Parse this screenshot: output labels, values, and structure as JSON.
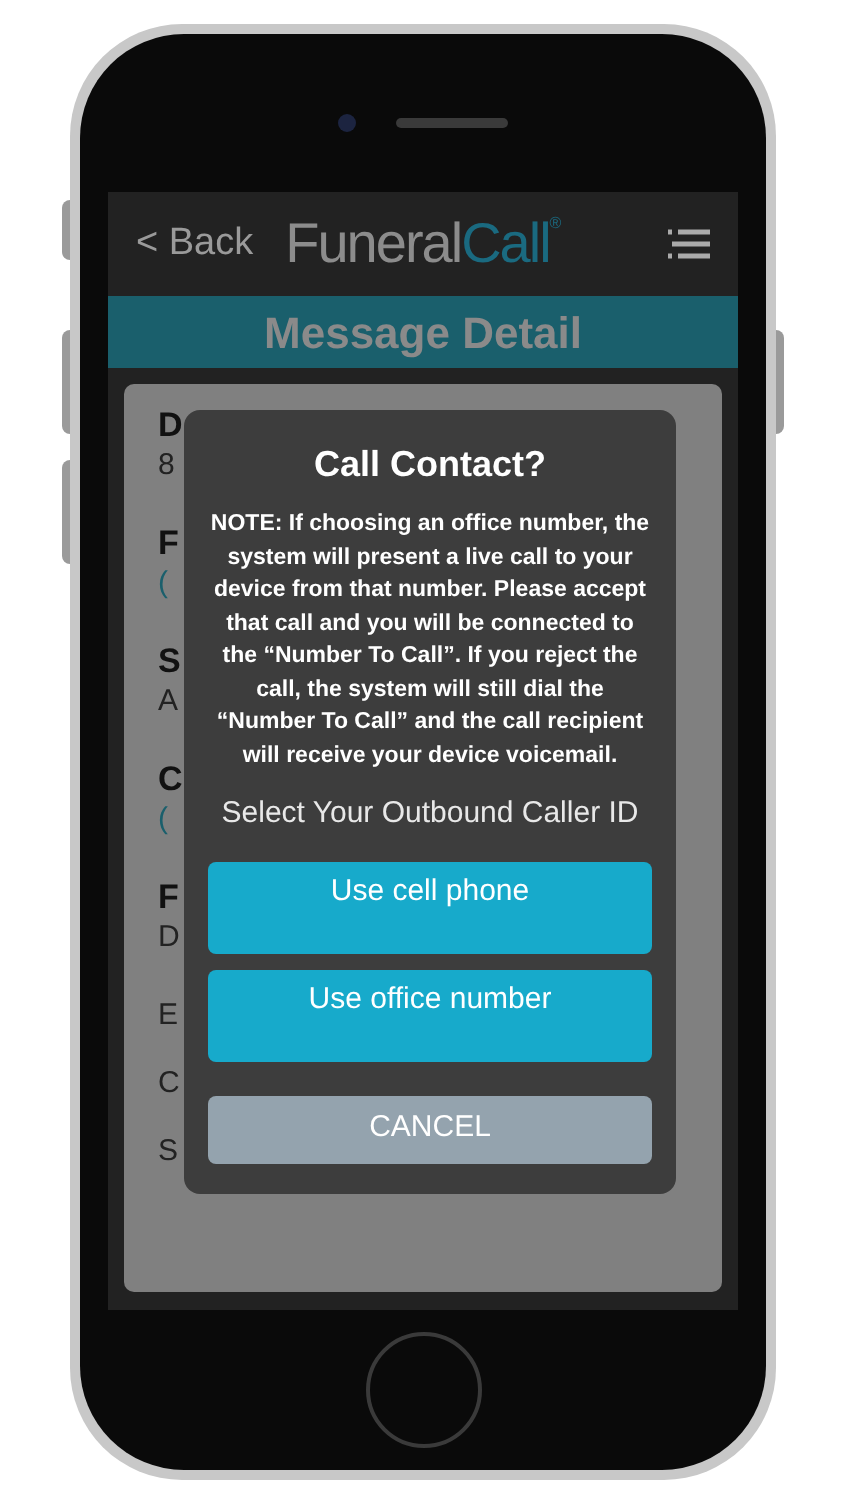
{
  "header": {
    "back": "< Back",
    "brand_first": "Funeral",
    "brand_second": "Call",
    "brand_mark": "®"
  },
  "title_bar": {
    "title": "Message Detail"
  },
  "fields": [
    {
      "label": "D",
      "value": "8",
      "link": false
    },
    {
      "label": "F",
      "value": "(",
      "link": true
    },
    {
      "label": "S",
      "value": "A",
      "link": false
    },
    {
      "label": "C",
      "value": "(",
      "link": true
    },
    {
      "label": "F",
      "value": "D",
      "link": false
    },
    {
      "label": "E"
    },
    {
      "label": "C"
    },
    {
      "label": "S"
    }
  ],
  "dialog": {
    "title": "Call Contact?",
    "note": "NOTE: If choosing an office number, the system will present a live call to your device from that number. Please accept that call and you will be connected to the “Number To Call”. If you reject the call, the system will still dial the “Number To Call” and the call recipient will receive your device voicemail.",
    "prompt": "Select Your Outbound Caller ID",
    "buttons": [
      {
        "label": "Use cell phone",
        "kind": "primary"
      },
      {
        "label": "Use office number",
        "kind": "primary"
      },
      {
        "label": "CANCEL",
        "kind": "cancel"
      }
    ]
  }
}
